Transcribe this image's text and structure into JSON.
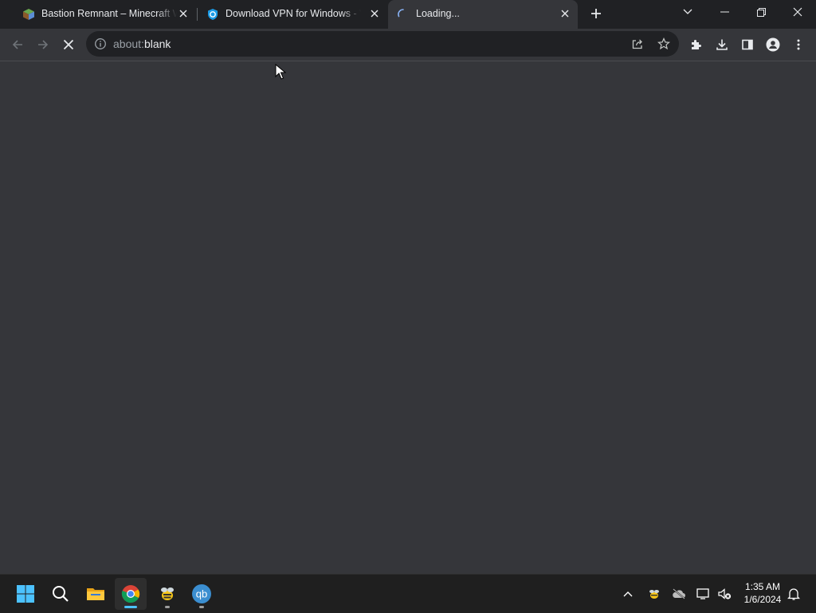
{
  "browser": {
    "tabs": [
      {
        "title": "Bastion Remnant – Minecraft Wiki",
        "active": false,
        "favicon": "minecraft-wiki-icon"
      },
      {
        "title": "Download VPN for Windows - VPN",
        "active": false,
        "favicon": "vpn-shield-icon"
      },
      {
        "title": "Loading...",
        "active": true,
        "favicon": "loading-spinner-icon"
      }
    ],
    "omnibox": {
      "prefix": "about:",
      "rest": "blank"
    }
  },
  "taskbar": {
    "clock_time": "1:35 AM",
    "clock_date": "1/6/2024"
  },
  "colors": {
    "accent": "#8ab4f8",
    "tabstrip": "#202124",
    "toolbar": "#35363a",
    "taskbar": "#1f1f1f"
  }
}
